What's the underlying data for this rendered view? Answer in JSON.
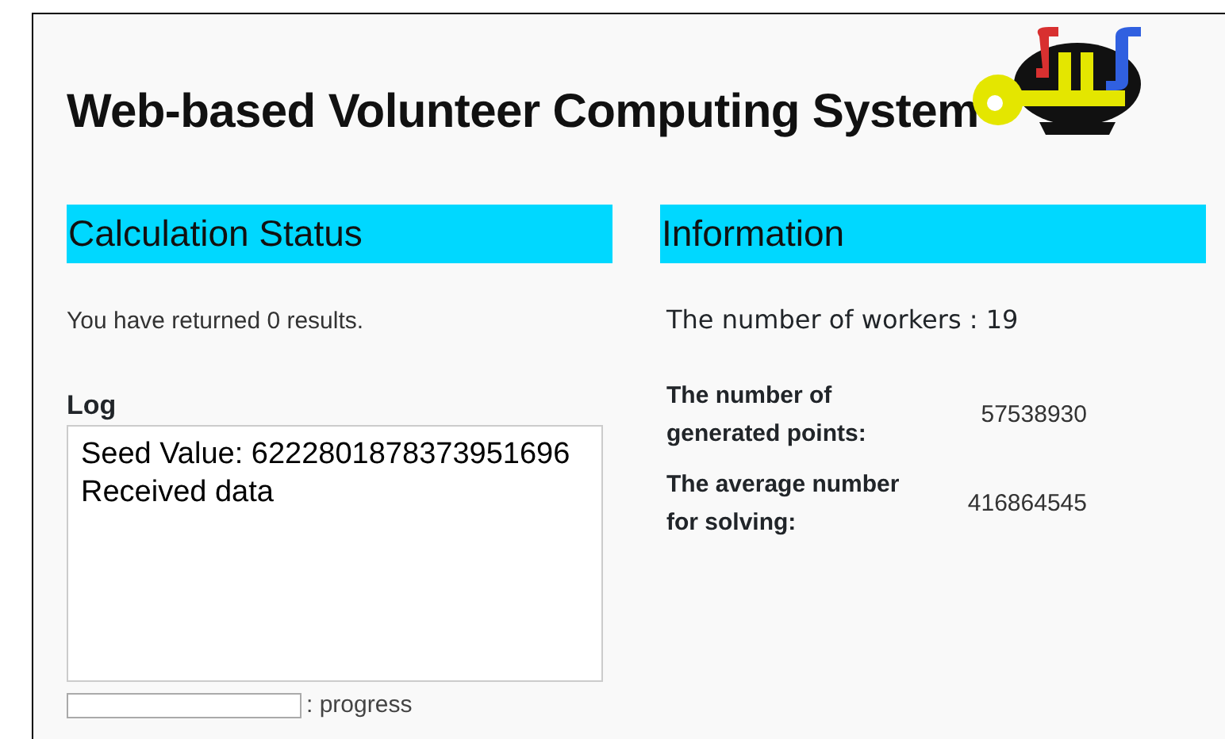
{
  "header": {
    "title": "Web-based Volunteer Computing System"
  },
  "calculation_status": {
    "heading": "Calculation Status",
    "message": "You have returned 0 results.",
    "log_label": "Log",
    "log_lines": [
      "Seed Value: 6222801878373951696",
      "Received data"
    ],
    "progress": {
      "level": 0,
      "label": ": progress"
    }
  },
  "information": {
    "heading": "Information",
    "workers": "The number of workers : 19",
    "stats": [
      {
        "label": "The number of generated points:",
        "value": "57538930"
      },
      {
        "label": "The average number for solving:",
        "value": "416864545"
      }
    ]
  }
}
